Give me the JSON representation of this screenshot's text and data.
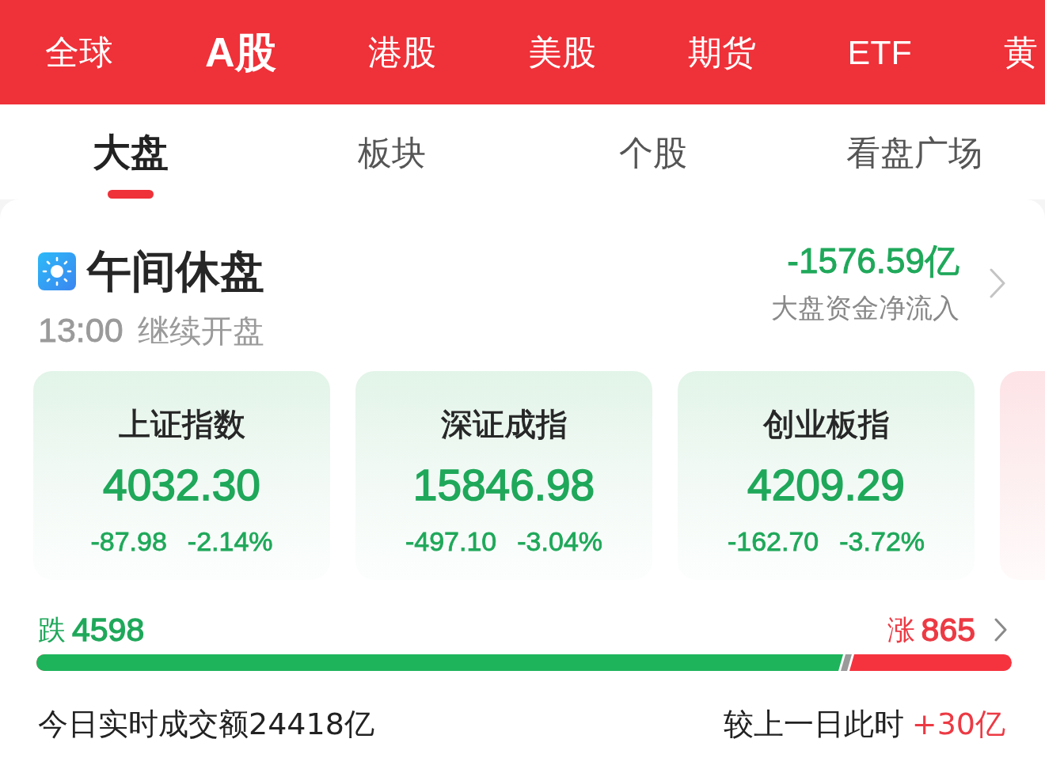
{
  "market_tabs": [
    {
      "label": "全球",
      "selected": false
    },
    {
      "label": "A股",
      "selected": true
    },
    {
      "label": "港股",
      "selected": false
    },
    {
      "label": "美股",
      "selected": false
    },
    {
      "label": "期货",
      "selected": false
    },
    {
      "label": "ETF",
      "selected": false
    },
    {
      "label": "黄",
      "selected": false
    }
  ],
  "view_tabs": [
    {
      "label": "大盘",
      "selected": true
    },
    {
      "label": "板块",
      "selected": false
    },
    {
      "label": "个股",
      "selected": false
    },
    {
      "label": "看盘广场",
      "selected": false
    }
  ],
  "session": {
    "title": "午间休盘",
    "resume_time": "13:00",
    "resume_label": "继续开盘"
  },
  "net_flow": {
    "value": "-1576.59亿",
    "label": "大盘资金净流入",
    "falling": true
  },
  "indices": [
    {
      "name": "上证指数",
      "value": "4032.30",
      "change": "-87.98",
      "change_pct": "-2.14%",
      "falling": true
    },
    {
      "name": "深证成指",
      "value": "15846.98",
      "change": "-497.10",
      "change_pct": "-3.04%",
      "falling": true
    },
    {
      "name": "创业板指",
      "value": "4209.29",
      "change": "-162.70",
      "change_pct": "-3.72%",
      "falling": true
    },
    {
      "falling": false
    }
  ],
  "breadth": {
    "fall_label": "跌",
    "fall_count": "4598",
    "rise_label": "涨",
    "rise_count": "865",
    "level": 0.83
  },
  "turnover": {
    "label": "今日实时成交额24418亿",
    "compare_label": "较上一日此时",
    "compare_value": "+30亿",
    "compare_rising": true
  }
}
